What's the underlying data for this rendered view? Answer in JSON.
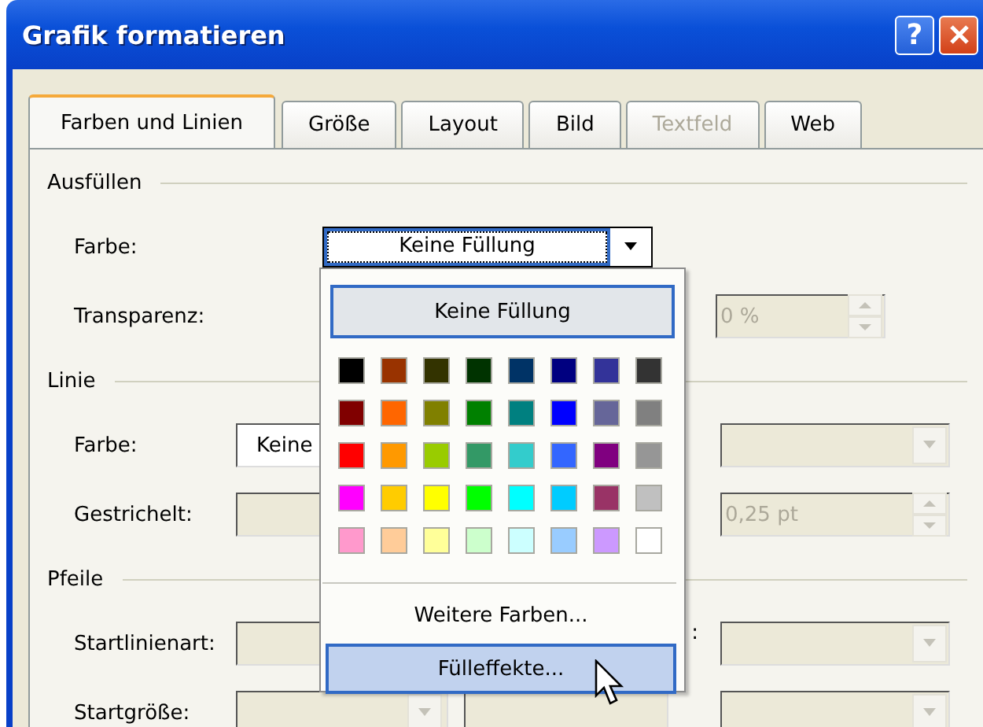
{
  "window": {
    "title": "Grafik formatieren",
    "help_label": "?"
  },
  "tabs": [
    {
      "label": "Farben und Linien",
      "selected": true,
      "disabled": false
    },
    {
      "label": "Größe",
      "selected": false,
      "disabled": false
    },
    {
      "label": "Layout",
      "selected": false,
      "disabled": false
    },
    {
      "label": "Bild",
      "selected": false,
      "disabled": false
    },
    {
      "label": "Textfeld",
      "selected": false,
      "disabled": true
    },
    {
      "label": "Web",
      "selected": false,
      "disabled": false
    }
  ],
  "sections": [
    {
      "title": "Ausfüllen",
      "rows": [
        {
          "label": "Farbe:",
          "left": {
            "kind": "combo",
            "value": "Keine Füllung"
          }
        },
        {
          "label": "Transparenz:",
          "right": {
            "kind": "spin",
            "value": "0 %",
            "disabled": true
          }
        }
      ]
    },
    {
      "title": "Linie",
      "rows": [
        {
          "label": "Farbe:",
          "left": {
            "kind": "field",
            "value": "Keine",
            "disabled": false
          },
          "right": {
            "kind": "combo",
            "disabled": true
          }
        },
        {
          "label": "Gestrichelt:",
          "left": {
            "kind": "field",
            "disabled": true
          },
          "right": {
            "kind": "spin",
            "value": "0,25 pt",
            "disabled": true
          }
        }
      ]
    },
    {
      "title": "Pfeile",
      "rows": [
        {
          "label": "Startlinienart:",
          "left": {
            "kind": "field",
            "disabled": true
          },
          "side_label": ":",
          "right": {
            "kind": "combo",
            "disabled": true
          }
        },
        {
          "label": "Startgröße:",
          "left": {
            "kind": "small-combo",
            "disabled": true
          },
          "right": {
            "kind": "combo",
            "disabled": true
          }
        }
      ]
    }
  ],
  "popup": {
    "none_button": "Keine Füllung",
    "colors": [
      {
        "color": "#000000"
      },
      {
        "color": "#993300"
      },
      {
        "color": "#333300"
      },
      {
        "color": "#003300"
      },
      {
        "color": "#003366"
      },
      {
        "color": "#000080"
      },
      {
        "color": "#333399"
      },
      {
        "color": "#333333"
      },
      {
        "color": "#800000"
      },
      {
        "color": "#ff6600"
      },
      {
        "color": "#808000"
      },
      {
        "color": "#008000"
      },
      {
        "color": "#008080"
      },
      {
        "color": "#0000ff"
      },
      {
        "color": "#666699"
      },
      {
        "color": "#808080"
      },
      {
        "color": "#ff0000"
      },
      {
        "color": "#ff9900"
      },
      {
        "color": "#99cc00"
      },
      {
        "color": "#339966"
      },
      {
        "color": "#33cccc"
      },
      {
        "color": "#3366ff"
      },
      {
        "color": "#800080"
      },
      {
        "color": "#969696"
      },
      {
        "color": "#ff00ff"
      },
      {
        "color": "#ffcc00"
      },
      {
        "color": "#ffff00"
      },
      {
        "color": "#00ff00"
      },
      {
        "color": "#00ffff"
      },
      {
        "color": "#00ccff"
      },
      {
        "color": "#993366"
      },
      {
        "color": "#c0c0c0"
      },
      {
        "color": "#ff99cc"
      },
      {
        "color": "#ffcc99"
      },
      {
        "color": "#ffff99"
      },
      {
        "color": "#ccffcc"
      },
      {
        "color": "#ccffff"
      },
      {
        "color": "#99ccff"
      },
      {
        "color": "#cc99ff"
      },
      {
        "color": "#ffffff"
      }
    ],
    "items": [
      {
        "label": "Weitere Farben...",
        "selected": false
      },
      {
        "label": "Fülleffekte...",
        "selected": true
      }
    ]
  }
}
